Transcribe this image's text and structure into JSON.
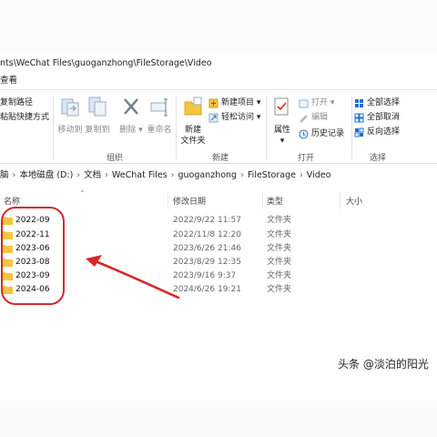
{
  "window": {
    "title": "nts\\WeChat Files\\guoganzhong\\FileStorage\\Video",
    "menu_label": "查看"
  },
  "ribbon": {
    "clipboard": {
      "copy_path": "复制路径",
      "paste_shortcut": "粘贴快捷方式"
    },
    "organize": {
      "move_to": "移动到",
      "copy_to": "复制到",
      "delete": "删除",
      "rename": "重命名",
      "label": "组织"
    },
    "new": {
      "new_folder_line1": "新建",
      "new_folder_line2": "文件夹",
      "new_item": "新建项目",
      "easy_access": "轻松访问",
      "label": "新建"
    },
    "open": {
      "properties": "属性",
      "open": "打开",
      "edit": "编辑",
      "history": "历史记录",
      "label": "打开"
    },
    "select": {
      "select_all": "全部选择",
      "select_none": "全部取消",
      "invert": "反向选择",
      "label": "选择"
    }
  },
  "address": {
    "prefix": "脑",
    "segments": [
      "本地磁盘 (D:)",
      "文档",
      "WeChat Files",
      "guoganzhong",
      "FileStorage",
      "Video"
    ]
  },
  "columns": {
    "name": "名称",
    "modified": "修改日期",
    "type": "类型",
    "size": "大小"
  },
  "files": [
    {
      "name": "2022-09",
      "modified": "2022/9/22 11:57",
      "type": "文件夹"
    },
    {
      "name": "2022-11",
      "modified": "2022/11/8 12:20",
      "type": "文件夹"
    },
    {
      "name": "2023-06",
      "modified": "2023/6/26 21:46",
      "type": "文件夹"
    },
    {
      "name": "2023-08",
      "modified": "2023/8/29 12:35",
      "type": "文件夹"
    },
    {
      "name": "2023-09",
      "modified": "2023/9/16 9:37",
      "type": "文件夹"
    },
    {
      "name": "2024-06",
      "modified": "2024/6/26 19:21",
      "type": "文件夹"
    }
  ],
  "watermark": "头条 @淡泊的阳光",
  "colors": {
    "folder": "#f4c542",
    "annotation": "#d42a2a",
    "accent": "#1e6fd9"
  }
}
